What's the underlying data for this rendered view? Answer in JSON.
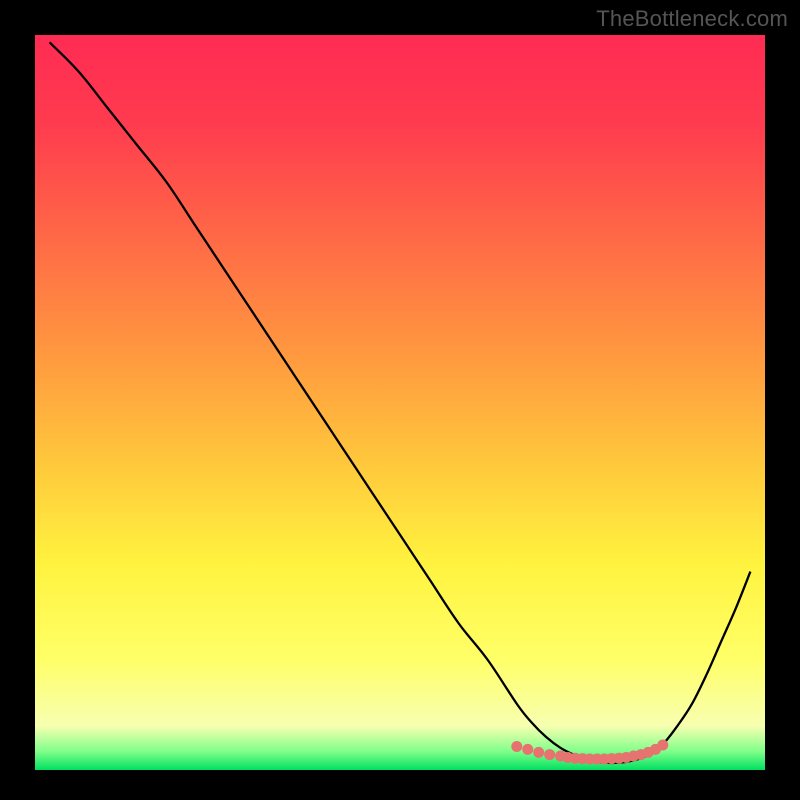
{
  "watermark": "TheBottleneck.com",
  "chart_data": {
    "type": "line",
    "title": "",
    "xlabel": "",
    "ylabel": "",
    "xlim": [
      0,
      100
    ],
    "ylim": [
      0,
      100
    ],
    "grid": false,
    "background_gradient": {
      "stops": [
        {
          "offset": 0.0,
          "color": "#ff2b53"
        },
        {
          "offset": 0.12,
          "color": "#ff3b4f"
        },
        {
          "offset": 0.28,
          "color": "#ff6a46"
        },
        {
          "offset": 0.44,
          "color": "#ff9a3f"
        },
        {
          "offset": 0.58,
          "color": "#ffc73c"
        },
        {
          "offset": 0.72,
          "color": "#fff33f"
        },
        {
          "offset": 0.85,
          "color": "#ffff68"
        },
        {
          "offset": 0.94,
          "color": "#f7ffb0"
        },
        {
          "offset": 0.975,
          "color": "#7fff8a"
        },
        {
          "offset": 1.0,
          "color": "#00e060"
        }
      ]
    },
    "series": [
      {
        "name": "bottleneck-curve",
        "color": "#000000",
        "x": [
          2,
          6,
          10,
          14,
          18,
          22,
          26,
          30,
          34,
          38,
          42,
          46,
          50,
          54,
          58,
          62,
          66,
          68,
          70,
          72,
          74,
          76,
          78,
          80,
          82,
          84,
          86,
          88,
          90,
          92,
          94,
          96,
          98
        ],
        "y": [
          99,
          95,
          90,
          85,
          80,
          74,
          68,
          62,
          56,
          50,
          44,
          38,
          32,
          26,
          20,
          15,
          9,
          6.5,
          4.5,
          3,
          2,
          1.3,
          1,
          1,
          1.3,
          2,
          3.5,
          6,
          9,
          13,
          17.5,
          22,
          27
        ]
      },
      {
        "name": "optimal-range-marker",
        "color": "#e6736f",
        "type": "scatter",
        "x": [
          66,
          67.5,
          69,
          70.5,
          72,
          73,
          74,
          75,
          76,
          77,
          78,
          79,
          80,
          81,
          82,
          83,
          84,
          85,
          86
        ],
        "y": [
          3.2,
          2.8,
          2.4,
          2.1,
          1.9,
          1.7,
          1.6,
          1.55,
          1.5,
          1.5,
          1.5,
          1.55,
          1.6,
          1.7,
          1.9,
          2.1,
          2.4,
          2.8,
          3.4
        ]
      }
    ]
  }
}
